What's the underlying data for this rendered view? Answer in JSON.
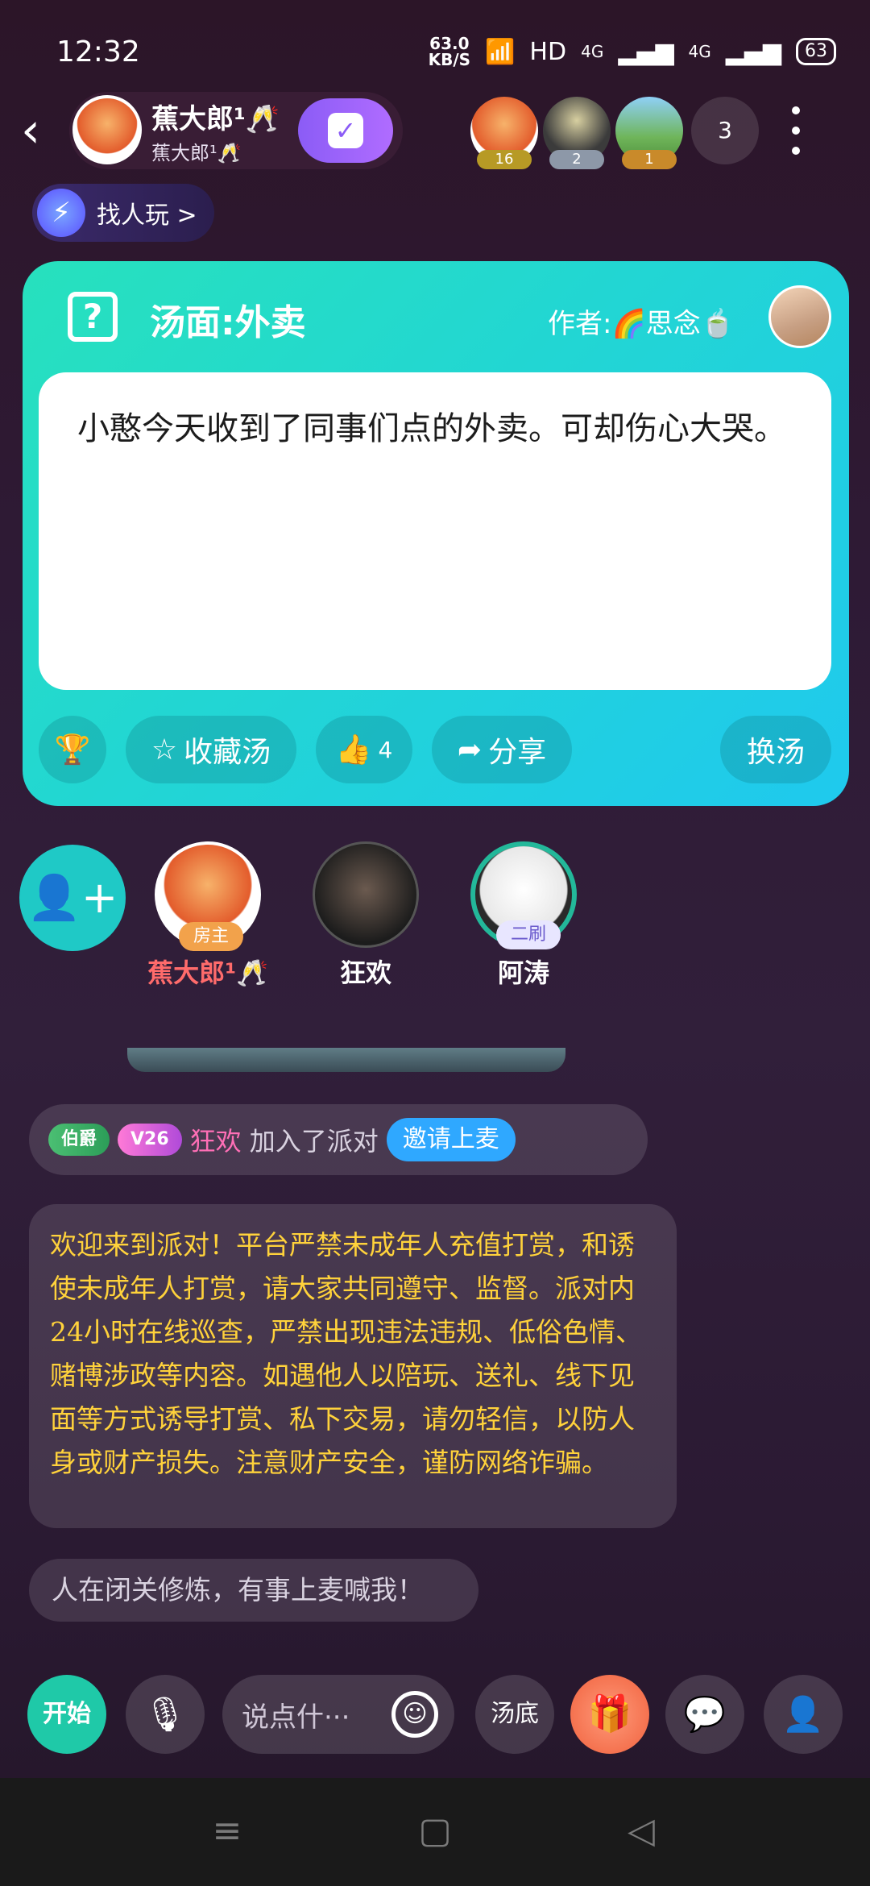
{
  "status": {
    "time": "12:32",
    "speed_value": "63.0",
    "speed_unit": "KB/S",
    "network": "HD",
    "net1": "4G",
    "net2": "4G",
    "battery": "63"
  },
  "header": {
    "host_name": "蕉大郎¹🥂",
    "host_sub": "蕉大郎¹🥂",
    "viewers": [
      {
        "badge": "16"
      },
      {
        "badge": "2"
      },
      {
        "badge": "1"
      }
    ],
    "viewer_count": "3"
  },
  "find_people": {
    "label": "找人玩 >"
  },
  "puzzle": {
    "title": "汤面:外卖",
    "author": "作者:🌈思念🍵",
    "text": "小憨今天收到了同事们点的外卖。可却伤心大哭。",
    "collect_label": "收藏汤",
    "like_count": "4",
    "share_label": "分享",
    "change_label": "换汤"
  },
  "seats": [
    {
      "name": "蕉大郎¹🥂",
      "tag": "房主",
      "color": "#ff6b6b"
    },
    {
      "name": "狂欢",
      "tag": "",
      "color": "#ffffff"
    },
    {
      "name": "阿涛",
      "tag": "二刷",
      "color": "#ffffff"
    }
  ],
  "chat": {
    "system": {
      "badge1": "伯爵",
      "badge2": "V26",
      "user": "狂欢",
      "text": "加入了派对",
      "invite": "邀请上麦"
    },
    "notice": "欢迎来到派对！平台严禁未成年人充值打赏，和诱使未成年人打赏，请大家共同遵守、监督。派对内24小时在线巡查，严禁出现违法违规、低俗色情、赌博涉政等内容。如遇他人以陪玩、送礼、线下见面等方式诱导打赏、私下交易，请勿轻信，以防人身或财产损失。注意财产安全，谨防网络诈骗。",
    "message": "人在闭关修炼，有事上麦喊我！"
  },
  "bottom": {
    "start": "开始",
    "input_placeholder": "说点什···",
    "soup_bottom": "汤底"
  },
  "icons": {
    "back": "back-arrow-icon",
    "mic": "microphone-icon",
    "emoji": "emoji-icon",
    "gift": "gift-icon",
    "chat": "chat-icon",
    "add_user": "add-user-icon"
  },
  "colors": {
    "card_start": "#27e1bd",
    "card_end": "#1fc9ee",
    "notice_text": "#ffd23b",
    "accent_purple": "#8b5cf6"
  }
}
